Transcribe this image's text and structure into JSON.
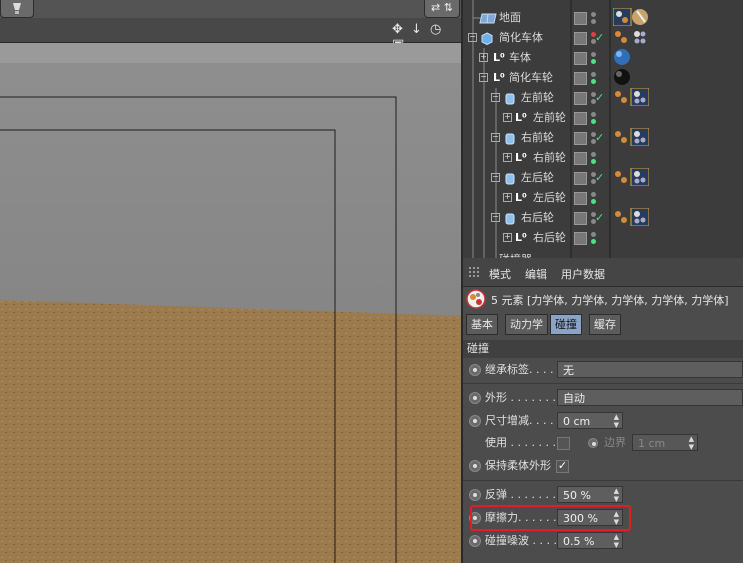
{
  "viewport": {
    "top_right_button": "⇄ ⇅",
    "nav_icons": "✥ ↓ ◷ ▣"
  },
  "object_manager": {
    "rows": [
      {
        "label": "地面"
      },
      {
        "label": "简化车体"
      },
      {
        "label": "车体"
      },
      {
        "label": "简化车轮"
      },
      {
        "label": "左前轮"
      },
      {
        "label": "左前轮"
      },
      {
        "label": "右前轮"
      },
      {
        "label": "右前轮"
      },
      {
        "label": "左后轮"
      },
      {
        "label": "左后轮"
      },
      {
        "label": "右后轮"
      },
      {
        "label": "右后轮"
      },
      {
        "label": "碰撞器"
      }
    ]
  },
  "attribute_manager": {
    "menu": {
      "mode": "模式",
      "edit": "编辑",
      "user_data": "用户数据"
    },
    "header": "5 元素 [力学体, 力学体, 力学体, 力学体, 力学体]",
    "tabs": {
      "basic": "基本",
      "dynamics": "动力学",
      "collision": "碰撞",
      "cache": "缓存"
    },
    "section_title": "碰撞",
    "props": {
      "inherit_tag": {
        "label": "继承标签. . . .",
        "value": "无"
      },
      "shape": {
        "label": "外形 . . . . . . . .",
        "value": "自动"
      },
      "size_increment": {
        "label": "尺寸增减. . . .",
        "value": "0 cm"
      },
      "use": {
        "label": "使用 . . . . . . .",
        "border_label": "边界",
        "border_value": "1 cm"
      },
      "keep_soft_shape": {
        "label": "保持柔体外形"
      },
      "bounce": {
        "label": "反弹 . . . . . . . .",
        "value": "50 %"
      },
      "friction": {
        "label": "摩擦力. . . . . .",
        "value": "300 %"
      },
      "collision_noise": {
        "label": "碰撞噪波 . . . .",
        "value": "0.5 %"
      }
    }
  },
  "colors": {
    "highlight": "#e02020",
    "active_tab": "#8aa3c7",
    "check": "#4fe08a"
  }
}
